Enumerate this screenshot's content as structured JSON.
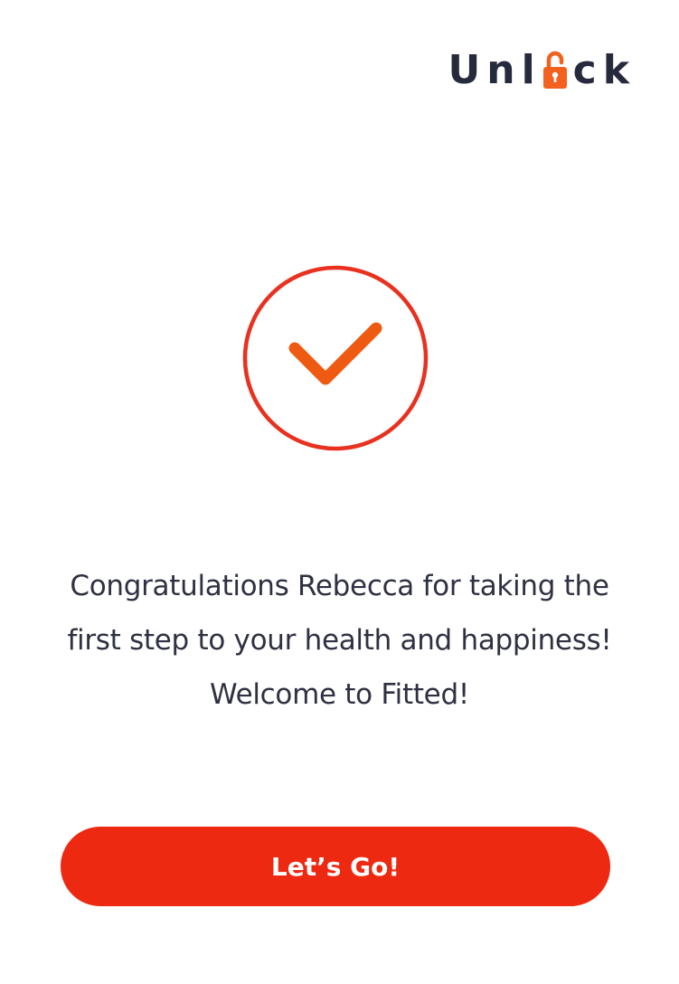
{
  "brand": {
    "prefix": "Unl",
    "suffix": "ck",
    "lock_icon": "open-padlock-icon",
    "text_color": "#262a3d",
    "accent_color": "#f2611e"
  },
  "success": {
    "icon": "checkmark-circle-icon",
    "ring_color": "#e8311f",
    "check_color": "#ef5a12"
  },
  "message": {
    "text": "Congratulations Rebecca for taking the first step to your health and happiness! Welcome to Fitted!"
  },
  "cta": {
    "label": "Let’s Go!",
    "color": "#ee2911"
  }
}
